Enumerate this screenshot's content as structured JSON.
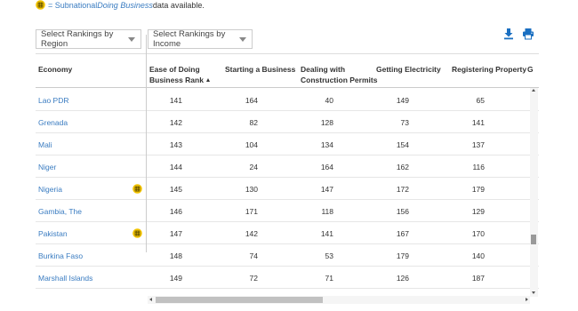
{
  "legend": {
    "prefix": "= Subnational ",
    "italic": "Doing Business",
    "suffix": " data available."
  },
  "filters": {
    "region": "Select Rankings by Region",
    "income": "Select Rankings by Income"
  },
  "icons": {
    "download": "download-icon",
    "print": "print-icon",
    "subnational": "subnational-grid-icon"
  },
  "colors": {
    "link": "#3a7cc1",
    "toolbar_icon": "#1a6fc1",
    "subnational_badge": "#f2c300"
  },
  "table": {
    "headers": {
      "economy": "Economy",
      "ease_line1": "Ease of Doing",
      "ease_line2": "Business Rank",
      "starting_business": "Starting a Business",
      "construction_line1": "Dealing with",
      "construction_line2": "Construction Permits",
      "electricity": "Getting Electricity",
      "property": "Registering Property",
      "next": "G"
    },
    "rows": [
      {
        "economy": "Lao PDR",
        "rank": "141",
        "starting": "164",
        "construction": "40",
        "electricity": "149",
        "property": "65",
        "subnational": false
      },
      {
        "economy": "Grenada",
        "rank": "142",
        "starting": "82",
        "construction": "128",
        "electricity": "73",
        "property": "141",
        "subnational": false
      },
      {
        "economy": "Mali",
        "rank": "143",
        "starting": "104",
        "construction": "134",
        "electricity": "154",
        "property": "137",
        "subnational": false
      },
      {
        "economy": "Niger",
        "rank": "144",
        "starting": "24",
        "construction": "164",
        "electricity": "162",
        "property": "116",
        "subnational": false
      },
      {
        "economy": "Nigeria",
        "rank": "145",
        "starting": "130",
        "construction": "147",
        "electricity": "172",
        "property": "179",
        "subnational": true
      },
      {
        "economy": "Gambia, The",
        "rank": "146",
        "starting": "171",
        "construction": "118",
        "electricity": "156",
        "property": "129",
        "subnational": false
      },
      {
        "economy": "Pakistan",
        "rank": "147",
        "starting": "142",
        "construction": "141",
        "electricity": "167",
        "property": "170",
        "subnational": true
      },
      {
        "economy": "Burkina Faso",
        "rank": "148",
        "starting": "74",
        "construction": "53",
        "electricity": "179",
        "property": "140",
        "subnational": false
      },
      {
        "economy": "Marshall Islands",
        "rank": "149",
        "starting": "72",
        "construction": "71",
        "electricity": "126",
        "property": "187",
        "subnational": false
      }
    ]
  }
}
